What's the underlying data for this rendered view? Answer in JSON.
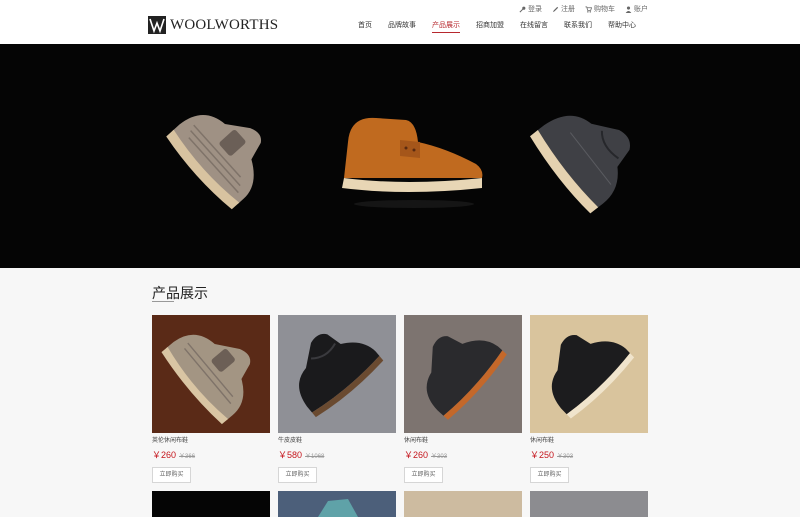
{
  "header": {
    "logo_text": "WOOLWORTHS",
    "top_links": [
      {
        "label": "登录",
        "icon": "key-icon"
      },
      {
        "label": "注册",
        "icon": "pencil-icon"
      },
      {
        "label": "购物车",
        "icon": "cart-icon"
      },
      {
        "label": "账户",
        "icon": "user-icon"
      }
    ],
    "nav": [
      {
        "label": "首页",
        "active": false
      },
      {
        "label": "品牌故事",
        "active": false
      },
      {
        "label": "产品展示",
        "active": true
      },
      {
        "label": "招商加盟",
        "active": false
      },
      {
        "label": "在线留言",
        "active": false
      },
      {
        "label": "联系我们",
        "active": false
      },
      {
        "label": "帮助中心",
        "active": false
      }
    ]
  },
  "section": {
    "title": "产品展示"
  },
  "products": [
    {
      "name": "英伦休闲布鞋",
      "price": "￥260",
      "old_price": "￥366",
      "buy_label": "立即购买",
      "bg": "#5a2a17"
    },
    {
      "name": "牛皮皮鞋",
      "price": "￥580",
      "old_price": "￥1068",
      "buy_label": "立即购买",
      "bg": "#8f9096"
    },
    {
      "name": "休闲布鞋",
      "price": "￥260",
      "old_price": "￥303",
      "buy_label": "立即购买",
      "bg": "#7d7470"
    },
    {
      "name": "休闲布鞋",
      "price": "￥250",
      "old_price": "￥303",
      "buy_label": "立即购买",
      "bg": "#d9c49d"
    }
  ],
  "colors": {
    "accent": "#b7282e",
    "price": "#c5161d"
  }
}
